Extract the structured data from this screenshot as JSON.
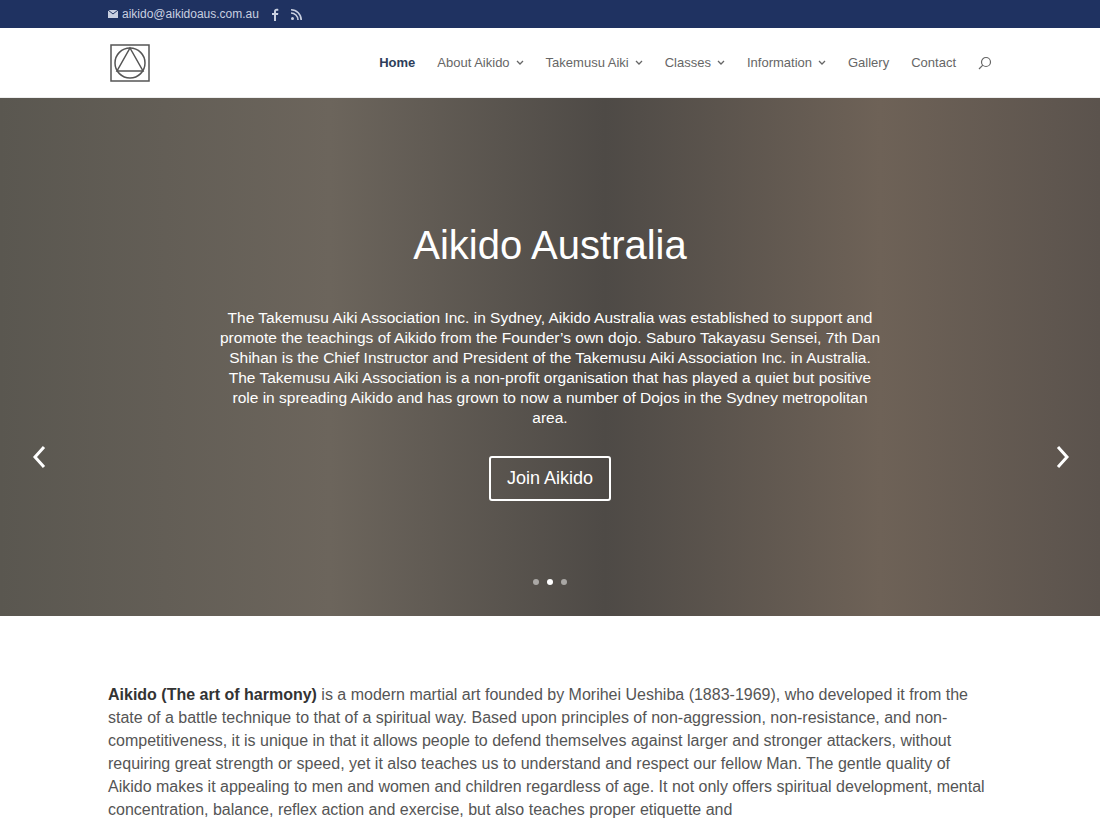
{
  "top_bar": {
    "email": "aikido@aikidoaus.com.au"
  },
  "nav": {
    "items": [
      {
        "label": "Home",
        "selected": true,
        "has_dropdown": false
      },
      {
        "label": "About Aikido",
        "selected": false,
        "has_dropdown": true
      },
      {
        "label": "Takemusu Aiki",
        "selected": false,
        "has_dropdown": true
      },
      {
        "label": "Classes",
        "selected": false,
        "has_dropdown": true
      },
      {
        "label": "Information",
        "selected": false,
        "has_dropdown": true
      },
      {
        "label": "Gallery",
        "selected": false,
        "has_dropdown": false
      },
      {
        "label": "Contact",
        "selected": false,
        "has_dropdown": false
      }
    ]
  },
  "hero": {
    "title": "Aikido Australia",
    "text": "The Takemusu Aiki Association Inc. in Sydney, Aikido Australia was established to support and promote the teachings of Aikido from the Founder’s own dojo. Saburo Takayasu Sensei, 7th Dan Shihan is the Chief Instructor and President of the Takemusu Aiki Association Inc. in Australia. The Takemusu Aiki Association is a non-profit organisation that has played a quiet but positive role in spreading Aikido and has grown to now a number of Dojos in the Sydney metropolitan area.",
    "button": "Join Aikido",
    "dots": [
      {
        "selected": false
      },
      {
        "selected": true
      },
      {
        "selected": false
      }
    ]
  },
  "content": {
    "bold": "Aikido (The art of harmony)",
    "text": " is a modern martial art founded by Morihei Ueshiba (1883-1969), who developed it from the state of a battle technique to that of a spiritual way. Based upon principles of non-aggression, non-resistance, and non-competitiveness, it is unique in that it allows people to defend themselves against larger and stronger attackers, without requiring great strength or speed, yet it also teaches us to understand and respect our fellow Man. The gentle quality of Aikido makes it appealing to men and women and children regardless of age. It not only offers spiritual development, mental concentration, balance, reflex action and exercise, but also teaches proper etiquette and"
  }
}
